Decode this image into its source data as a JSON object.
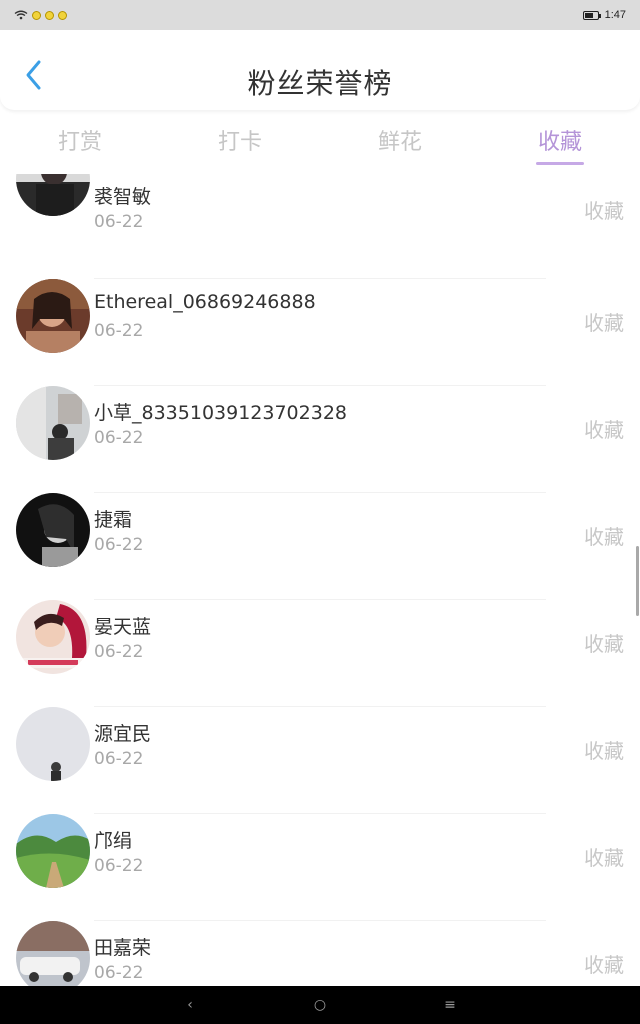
{
  "status_bar": {
    "time": "1:47",
    "battery_level": 0.7,
    "icons": [
      "wifi-icon",
      "notification-icon",
      "notification-icon",
      "notification-icon",
      "battery-icon"
    ]
  },
  "header": {
    "title": "粉丝荣誉榜",
    "back_icon": "chevron-left-icon"
  },
  "tabs": [
    {
      "label": "打赏",
      "active": false
    },
    {
      "label": "打卡",
      "active": false
    },
    {
      "label": "鲜花",
      "active": false
    },
    {
      "label": "收藏",
      "active": true
    }
  ],
  "list": [
    {
      "name": "裘智敏",
      "date": "06-22",
      "action": "收藏"
    },
    {
      "name": "Ethereal_06869246888",
      "date": "06-22",
      "action": "收藏"
    },
    {
      "name": "小草_83351039123702328",
      "date": "06-22",
      "action": "收藏"
    },
    {
      "name": "捷霜",
      "date": "06-22",
      "action": "收藏"
    },
    {
      "name": "晏天蓝",
      "date": "06-22",
      "action": "收藏"
    },
    {
      "name": "源宜民",
      "date": "06-22",
      "action": "收藏"
    },
    {
      "name": "邝绢",
      "date": "06-22",
      "action": "收藏"
    },
    {
      "name": "田嘉荣",
      "date": "06-22",
      "action": "收藏"
    }
  ],
  "nav_bar": {
    "back_label": "‹",
    "home_label": "○",
    "menu_label": "≡"
  },
  "colors": {
    "accent": "#b494d8",
    "tab_inactive": "#c6c6c6",
    "back_arrow": "#3b9fe6"
  }
}
